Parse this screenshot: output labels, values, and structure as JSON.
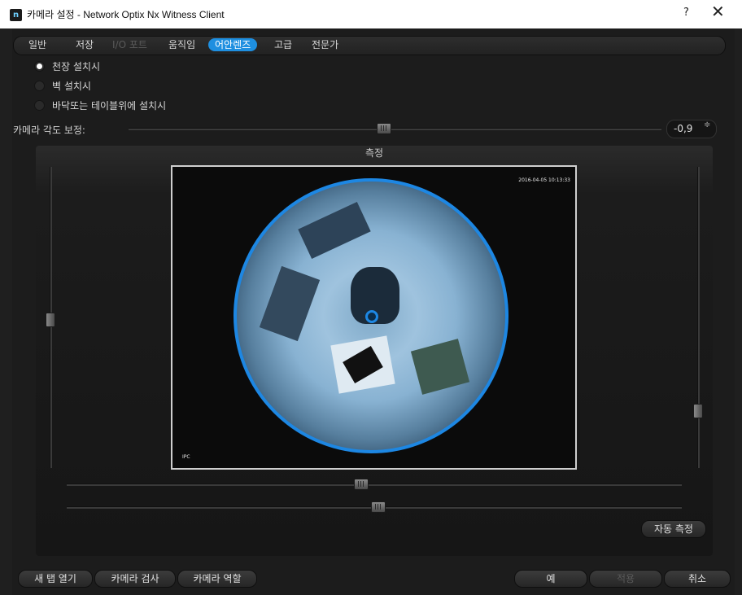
{
  "window": {
    "title": "카메라 설정 - Network Optix Nx Witness Client",
    "help": "?",
    "close": "✕",
    "app_icon": "n"
  },
  "tabs": [
    {
      "label": "일반",
      "state": "normal"
    },
    {
      "label": "저장",
      "state": "normal"
    },
    {
      "label": "I/O 포트",
      "state": "disabled"
    },
    {
      "label": "움직임",
      "state": "normal"
    },
    {
      "label": "어안렌즈",
      "state": "active"
    },
    {
      "label": "고급",
      "state": "normal"
    },
    {
      "label": "전문가",
      "state": "normal"
    }
  ],
  "mount_options": [
    {
      "label": "천장 설치시",
      "checked": true
    },
    {
      "label": "벽 설치시",
      "checked": false
    },
    {
      "label": "바닥또는 테이블위에 설치시",
      "checked": false
    }
  ],
  "angle": {
    "label": "카메라 각도 보정:",
    "value": "-0,9",
    "spin_arrows": "≑"
  },
  "calibration": {
    "title": "측정",
    "timestamp": "2016-04-05 10:13:33",
    "camera_label": "IPC",
    "auto_button": "자동 측정"
  },
  "footer": {
    "left_buttons": [
      "새 탭 열기",
      "카메라 검사",
      "카메라 역할"
    ],
    "ok": "예",
    "apply": "적용",
    "cancel": "취소"
  },
  "colors": {
    "accent": "#1e8fe0",
    "background": "#1c1c1c"
  }
}
